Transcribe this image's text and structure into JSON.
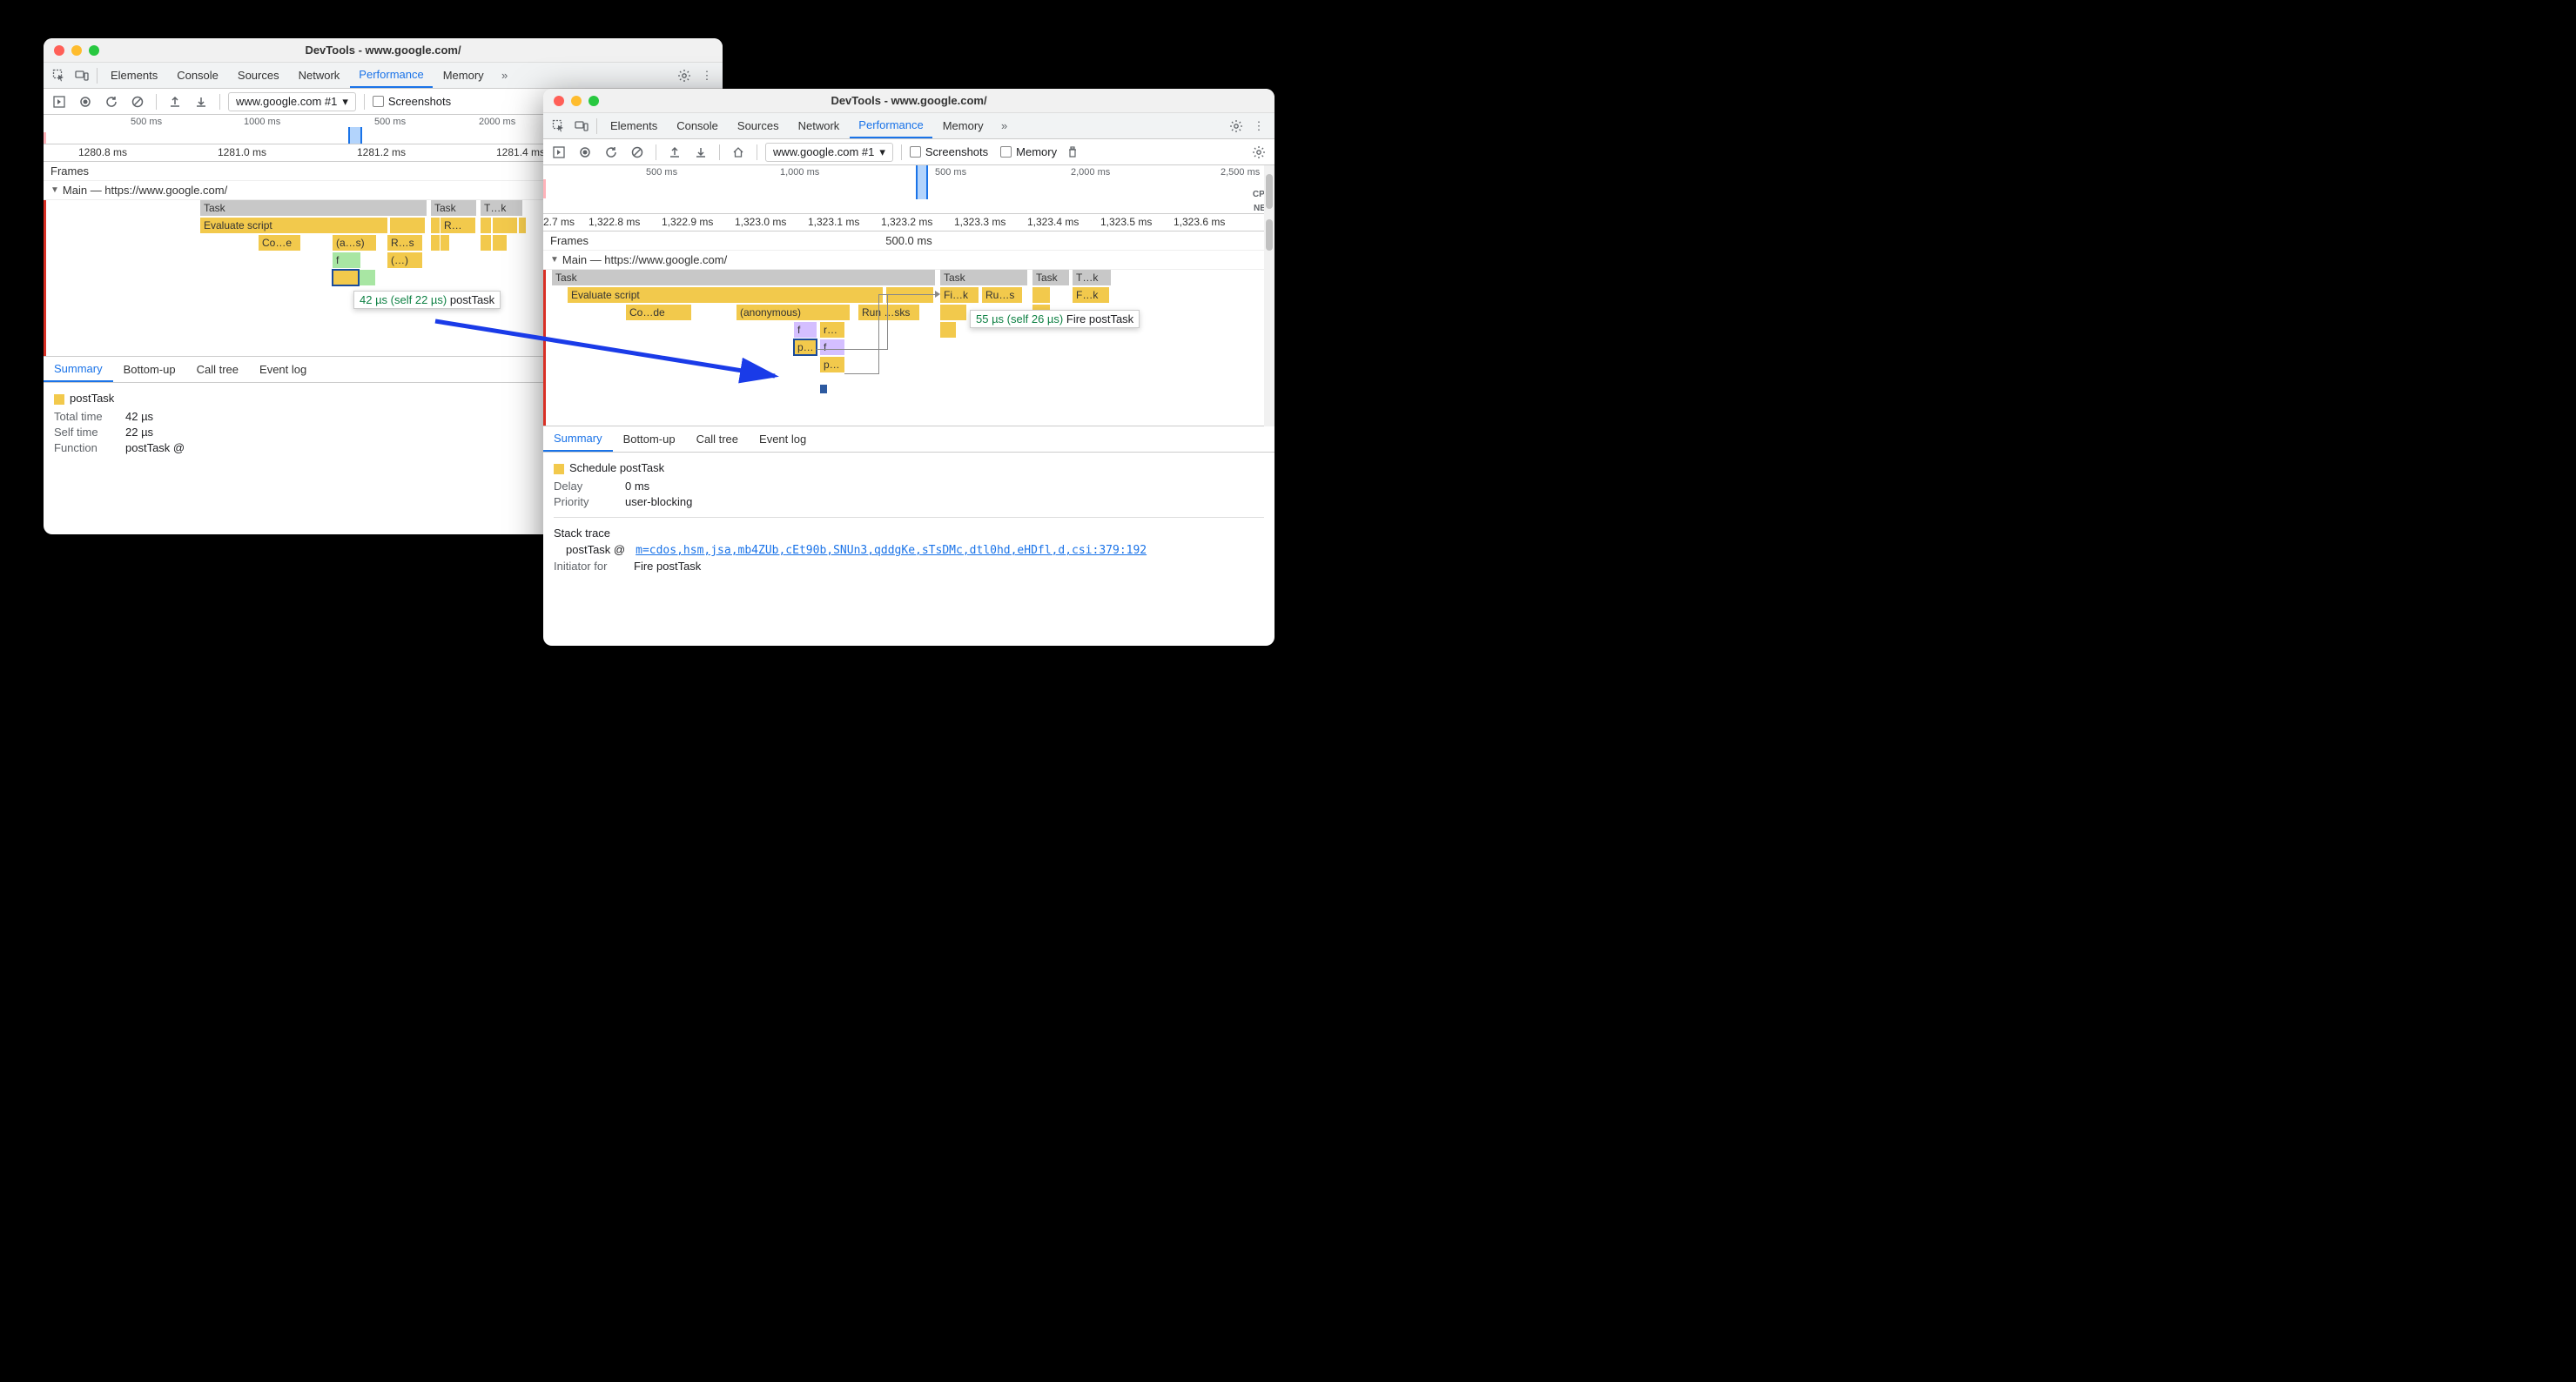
{
  "leftWindow": {
    "title": "DevTools - www.google.com/",
    "tabs": [
      "Elements",
      "Console",
      "Sources",
      "Network",
      "Performance",
      "Memory"
    ],
    "activeTab": "Performance",
    "recordingSelect": "www.google.com #1",
    "screenshotsLabel": "Screenshots",
    "overviewTicks": [
      "500 ms",
      "1000 ms",
      "500 ms",
      "2000 ms"
    ],
    "rulerTicks": [
      "1280.8 ms",
      "1281.0 ms",
      "1281.2 ms",
      "1281.4 ms"
    ],
    "framesLabel": "Frames",
    "mainLabel": "Main — https://www.google.com/",
    "bars": {
      "task1": "Task",
      "task2": "Task",
      "task3": "T…k",
      "eval": "Evaluate script",
      "r": "R…",
      "code": "Co…e",
      "as": "(a…s)",
      "rs": "R…s",
      "f": "f",
      "paren": "(…)"
    },
    "tooltip": {
      "time": "42 µs (self 22 µs)",
      "name": "postTask"
    },
    "bottomTabs": [
      "Summary",
      "Bottom-up",
      "Call tree",
      "Event log"
    ],
    "summary": {
      "name": "postTask",
      "totalTimeLabel": "Total time",
      "totalTime": "42 µs",
      "selfTimeLabel": "Self time",
      "selfTime": "22 µs",
      "functionLabel": "Function",
      "functionValue": "postTask @"
    }
  },
  "rightWindow": {
    "title": "DevTools - www.google.com/",
    "tabs": [
      "Elements",
      "Console",
      "Sources",
      "Network",
      "Performance",
      "Memory"
    ],
    "activeTab": "Performance",
    "recordingSelect": "www.google.com #1",
    "screenshotsLabel": "Screenshots",
    "memoryLabel": "Memory",
    "overviewTicks": [
      "500 ms",
      "1,000 ms",
      "500 ms",
      "2,000 ms",
      "2,500 ms"
    ],
    "cpuLabel": "CPU",
    "netLabel": "NET",
    "rulerTicks": [
      "2.7 ms",
      "1,322.8 ms",
      "1,322.9 ms",
      "1,323.0 ms",
      "1,323.1 ms",
      "1,323.2 ms",
      "1,323.3 ms",
      "1,323.4 ms",
      "1,323.5 ms",
      "1,323.6 ms"
    ],
    "framesLabel": "Frames",
    "framesDuration": "500.0 ms",
    "mainLabel": "Main — https://www.google.com/",
    "bars": {
      "task1": "Task",
      "task2": "Task",
      "task3": "Task",
      "task4": "T…k",
      "eval": "Evaluate script",
      "fik": "Fi…k",
      "rus": "Ru…s",
      "fk": "F…k",
      "code": "Co…de",
      "anon": "(anonymous)",
      "run": "Run …sks",
      "f": "f",
      "r": "r…",
      "p1": "p…",
      "f2": "f",
      "p2": "p…"
    },
    "tooltip": {
      "time": "55 µs (self 26 µs)",
      "name": "Fire postTask"
    },
    "bottomTabs": [
      "Summary",
      "Bottom-up",
      "Call tree",
      "Event log"
    ],
    "summary": {
      "name": "Schedule postTask",
      "delayLabel": "Delay",
      "delay": "0 ms",
      "priorityLabel": "Priority",
      "priority": "user-blocking",
      "stackTraceLabel": "Stack trace",
      "stackFn": "postTask @",
      "stackLink": "m=cdos,hsm,jsa,mb4ZUb,cEt90b,SNUn3,qddgKe,sTsDMc,dtl0hd,eHDfl,d,csi:379:192",
      "initiatorLabel": "Initiator for",
      "initiatorValue": "Fire postTask"
    }
  }
}
